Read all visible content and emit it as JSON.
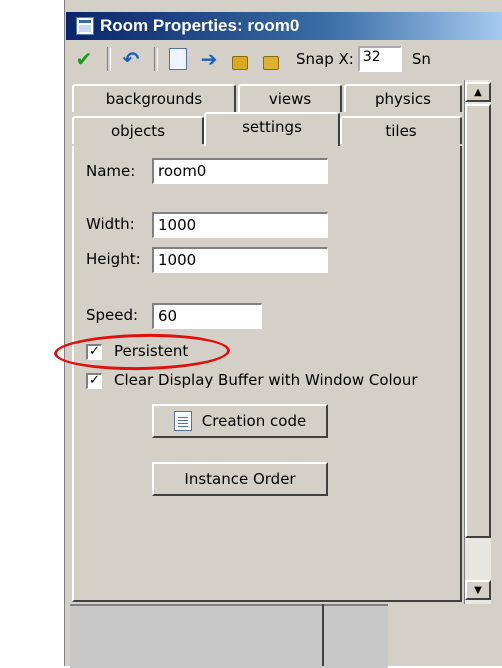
{
  "window": {
    "title": "Room Properties: room0"
  },
  "toolbar": {
    "ok_icon": "checkmark-icon",
    "undo_icon": "undo-icon",
    "page_icon": "page-icon",
    "arrow_icon": "arrow-right-icon",
    "lock_icon": "lock-icon",
    "unlock_icon": "unlock-icon",
    "snap_x_label": "Snap X:",
    "snap_x_value": "32",
    "snap_y_label": "Sn"
  },
  "tabs": {
    "row1": [
      "backgrounds",
      "views",
      "physics"
    ],
    "row2": [
      "objects",
      "settings",
      "tiles"
    ],
    "active": "settings"
  },
  "settings": {
    "name_label": "Name:",
    "name_value": "room0",
    "width_label": "Width:",
    "width_value": "1000",
    "height_label": "Height:",
    "height_value": "1000",
    "speed_label": "Speed:",
    "speed_value": "60",
    "persistent_label": "Persistent",
    "persistent_checked": true,
    "clear_display_label": "Clear Display Buffer with Window Colour",
    "clear_display_checked": true,
    "creation_code_button": "Creation code",
    "instance_order_button": "Instance Order"
  },
  "colors": {
    "window_bg": "#d4d0c8",
    "titlebar_start": "#0a246a",
    "titlebar_end": "#a6caf0",
    "annotation_red": "#e01010"
  }
}
